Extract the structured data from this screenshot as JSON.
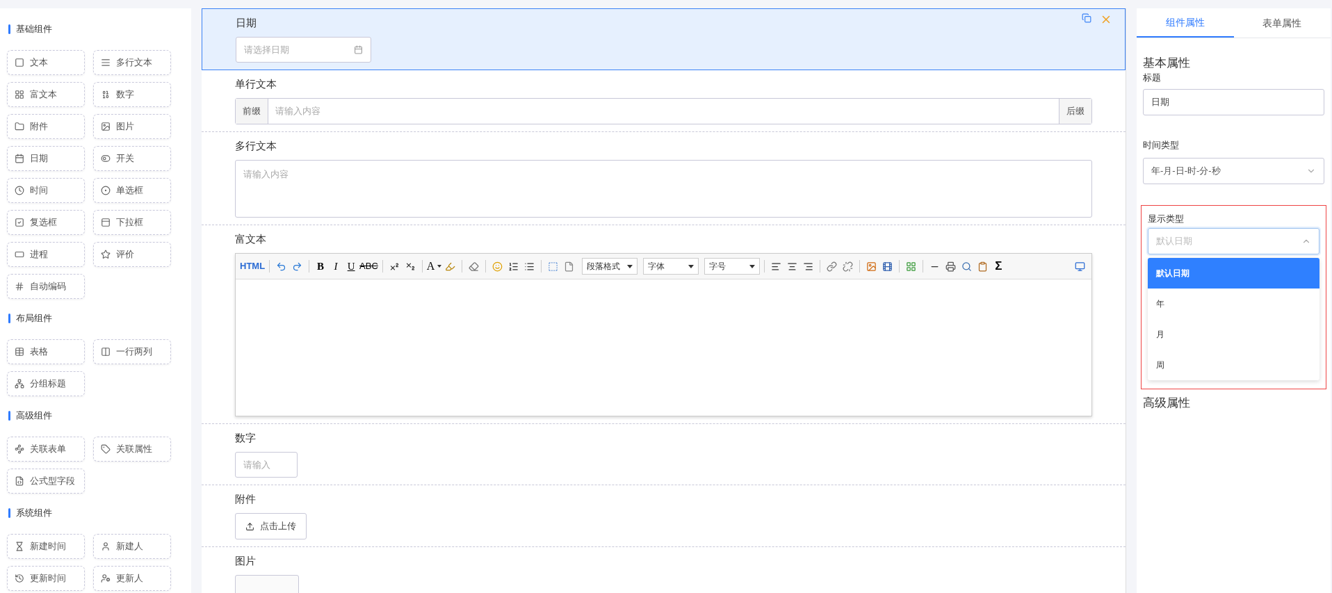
{
  "sidebar": {
    "sections": [
      {
        "title": "基础组件",
        "items": [
          {
            "label": "文本"
          },
          {
            "label": "多行文本"
          },
          {
            "label": "富文本"
          },
          {
            "label": "数字"
          },
          {
            "label": "附件"
          },
          {
            "label": "图片"
          },
          {
            "label": "日期"
          },
          {
            "label": "开关"
          },
          {
            "label": "时间"
          },
          {
            "label": "单选框"
          },
          {
            "label": "复选框"
          },
          {
            "label": "下拉框"
          },
          {
            "label": "进程"
          },
          {
            "label": "评价"
          },
          {
            "label": "自动编码"
          }
        ]
      },
      {
        "title": "布局组件",
        "items": [
          {
            "label": "表格"
          },
          {
            "label": "一行两列"
          },
          {
            "label": "分组标题"
          }
        ]
      },
      {
        "title": "高级组件",
        "items": [
          {
            "label": "关联表单"
          },
          {
            "label": "关联属性"
          },
          {
            "label": "公式型字段"
          }
        ]
      },
      {
        "title": "系统组件",
        "items": [
          {
            "label": "新建时间"
          },
          {
            "label": "新建人"
          },
          {
            "label": "更新时间"
          },
          {
            "label": "更新人"
          }
        ]
      }
    ]
  },
  "canvas": {
    "fields": [
      {
        "kind": "date",
        "label": "日期",
        "placeholder": "请选择日期",
        "selected": true
      },
      {
        "kind": "text",
        "label": "单行文本",
        "prefix": "前缀",
        "placeholder": "请输入内容",
        "suffix": "后缀",
        "selected": false
      },
      {
        "kind": "textarea",
        "label": "多行文本",
        "placeholder": "请输入内容",
        "selected": false
      },
      {
        "kind": "richtext",
        "label": "富文本",
        "selected": false
      },
      {
        "kind": "number",
        "label": "数字",
        "placeholder": "请输入",
        "selected": false
      },
      {
        "kind": "upload",
        "label": "附件",
        "button": "点击上传",
        "selected": false
      },
      {
        "kind": "image",
        "label": "图片",
        "selected": false
      }
    ]
  },
  "toolbar": {
    "html": "HTML",
    "bold": "B",
    "italic": "I",
    "underline": "U",
    "strike": "ABC",
    "font_color": "A",
    "selects": [
      "段落格式",
      "字体",
      "字号"
    ],
    "formula": "Σ"
  },
  "panel": {
    "tabs": [
      {
        "label": "组件属性",
        "selected": true
      },
      {
        "label": "表单属性",
        "selected": false
      }
    ],
    "basic_title": "基本属性",
    "title_field": {
      "label": "标题",
      "value": "日期"
    },
    "time_type": {
      "label": "时间类型",
      "value": "年-月-日-时-分-秒"
    },
    "display_type": {
      "label": "显示类型",
      "placeholder": "默认日期",
      "expanded": true,
      "highlighted": true,
      "options": [
        {
          "label": "默认日期",
          "selected": true
        },
        {
          "label": "年",
          "selected": false
        },
        {
          "label": "月",
          "selected": false
        },
        {
          "label": "周",
          "selected": false
        }
      ]
    },
    "advanced_title": "高级属性"
  }
}
